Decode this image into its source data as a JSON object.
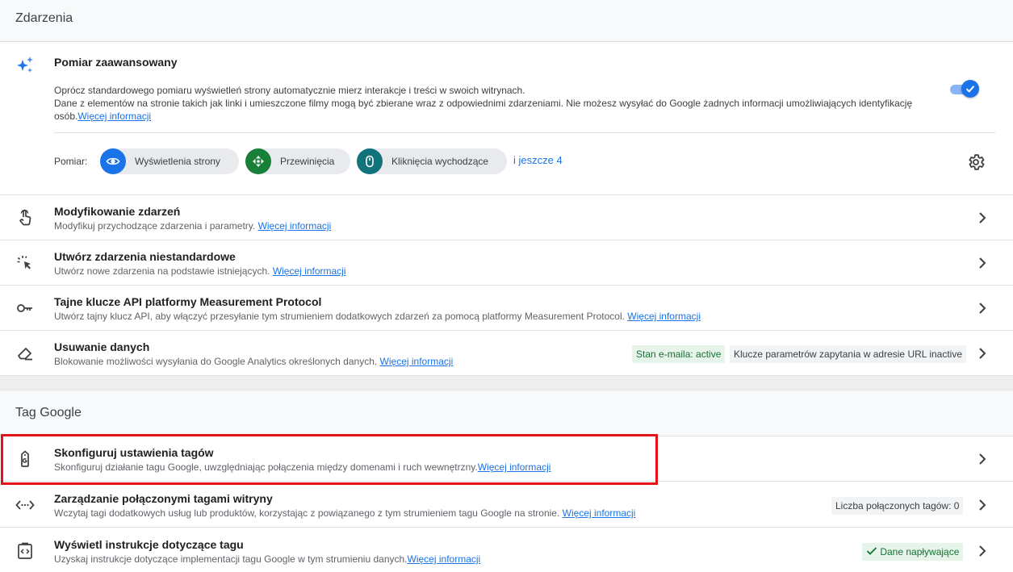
{
  "events_section": {
    "title": "Zdarzenia"
  },
  "enhanced": {
    "icon": "sparkle-icon",
    "title": "Pomiar zaawansowany",
    "desc_line1": "Oprócz standardowego pomiaru wyświetleń strony automatycznie mierz interakcje i treści w swoich witrynach.",
    "desc_line2": "Dane z elementów na stronie takich jak linki i umieszczone filmy mogą być zbierane wraz z odpowiednimi zdarzeniami. Nie możesz wysyłać do Google żadnych informacji umożliwiających identyfikację osób.",
    "link": "Więcej informacji",
    "toggle_on": true,
    "measure_label": "Pomiar:",
    "chips": [
      {
        "label": "Wyświetlenia strony",
        "icon": "eye-icon",
        "color": "#1a73e8"
      },
      {
        "label": "Przewinięcia",
        "icon": "scroll-arrows-icon",
        "color": "#188038"
      },
      {
        "label": "Kliknięcia wychodzące",
        "icon": "mouse-icon",
        "color": "#12737a"
      }
    ],
    "more": "i jeszcze 4"
  },
  "event_rows": [
    {
      "title": "Modyfikowanie zdarzeń",
      "desc": "Modyfikuj przychodzące zdarzenia i parametry.",
      "link": "Więcej informacji",
      "icon": "touch-hand-icon"
    },
    {
      "title": "Utwórz zdarzenia niestandardowe",
      "desc": "Utwórz nowe zdarzenia na podstawie istniejących.",
      "link": "Więcej informacji",
      "icon": "cursor-click-icon"
    },
    {
      "title": "Tajne klucze API platformy Measurement Protocol",
      "desc": "Utwórz tajny klucz API, aby włączyć przesyłanie tym strumieniem dodatkowych zdarzeń za pomocą platformy Measurement Protocol.",
      "link": "Więcej informacji",
      "icon": "key-icon"
    },
    {
      "title": "Usuwanie danych",
      "desc": "Blokowanie możliwości wysyłania do Google Analytics określonych danych.",
      "link": "Więcej informacji",
      "icon": "eraser-icon",
      "badges": [
        "Stan e-maila: active",
        "Klucze parametrów zapytania w adresie URL inactive"
      ]
    }
  ],
  "tag_section": {
    "title": "Tag Google"
  },
  "tag_rows": [
    {
      "title": "Skonfiguruj ustawienia tagów",
      "desc": "Skonfiguruj działanie tagu Google, uwzględniając połączenia między domenami i ruch wewnętrzny.",
      "link": "Więcej informacji",
      "icon": "google-tag-icon"
    },
    {
      "title": "Zarządzanie połączonymi tagami witryny",
      "desc": "Wczytaj tagi dodatkowych usług lub produktów, korzystając z powiązanego z tym strumieniem tagu Google na stronie.",
      "link": "Więcej informacji",
      "icon": "code-arrows-icon",
      "badge": "Liczba połączonych tagów: 0"
    },
    {
      "title": "Wyświetl instrukcje dotyczące tagu",
      "desc": "Uzyskaj instrukcje dotyczące implementacji tagu Google w tym strumieniu danych.",
      "link": "Więcej informacji",
      "icon": "code-clipboard-icon",
      "badge": "Dane napływające"
    }
  ],
  "colors": {
    "accent": "#1a73e8",
    "highlight": "#e3121b",
    "success": "#137333"
  }
}
